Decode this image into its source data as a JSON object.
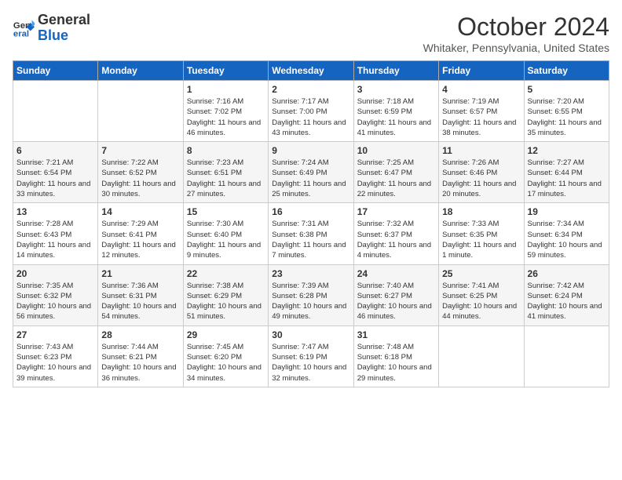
{
  "logo": {
    "general": "General",
    "blue": "Blue"
  },
  "header": {
    "month": "October 2024",
    "location": "Whitaker, Pennsylvania, United States"
  },
  "days_of_week": [
    "Sunday",
    "Monday",
    "Tuesday",
    "Wednesday",
    "Thursday",
    "Friday",
    "Saturday"
  ],
  "weeks": [
    [
      {
        "day": "",
        "sunrise": "",
        "sunset": "",
        "daylight": ""
      },
      {
        "day": "",
        "sunrise": "",
        "sunset": "",
        "daylight": ""
      },
      {
        "day": "1",
        "sunrise": "Sunrise: 7:16 AM",
        "sunset": "Sunset: 7:02 PM",
        "daylight": "Daylight: 11 hours and 46 minutes."
      },
      {
        "day": "2",
        "sunrise": "Sunrise: 7:17 AM",
        "sunset": "Sunset: 7:00 PM",
        "daylight": "Daylight: 11 hours and 43 minutes."
      },
      {
        "day": "3",
        "sunrise": "Sunrise: 7:18 AM",
        "sunset": "Sunset: 6:59 PM",
        "daylight": "Daylight: 11 hours and 41 minutes."
      },
      {
        "day": "4",
        "sunrise": "Sunrise: 7:19 AM",
        "sunset": "Sunset: 6:57 PM",
        "daylight": "Daylight: 11 hours and 38 minutes."
      },
      {
        "day": "5",
        "sunrise": "Sunrise: 7:20 AM",
        "sunset": "Sunset: 6:55 PM",
        "daylight": "Daylight: 11 hours and 35 minutes."
      }
    ],
    [
      {
        "day": "6",
        "sunrise": "Sunrise: 7:21 AM",
        "sunset": "Sunset: 6:54 PM",
        "daylight": "Daylight: 11 hours and 33 minutes."
      },
      {
        "day": "7",
        "sunrise": "Sunrise: 7:22 AM",
        "sunset": "Sunset: 6:52 PM",
        "daylight": "Daylight: 11 hours and 30 minutes."
      },
      {
        "day": "8",
        "sunrise": "Sunrise: 7:23 AM",
        "sunset": "Sunset: 6:51 PM",
        "daylight": "Daylight: 11 hours and 27 minutes."
      },
      {
        "day": "9",
        "sunrise": "Sunrise: 7:24 AM",
        "sunset": "Sunset: 6:49 PM",
        "daylight": "Daylight: 11 hours and 25 minutes."
      },
      {
        "day": "10",
        "sunrise": "Sunrise: 7:25 AM",
        "sunset": "Sunset: 6:47 PM",
        "daylight": "Daylight: 11 hours and 22 minutes."
      },
      {
        "day": "11",
        "sunrise": "Sunrise: 7:26 AM",
        "sunset": "Sunset: 6:46 PM",
        "daylight": "Daylight: 11 hours and 20 minutes."
      },
      {
        "day": "12",
        "sunrise": "Sunrise: 7:27 AM",
        "sunset": "Sunset: 6:44 PM",
        "daylight": "Daylight: 11 hours and 17 minutes."
      }
    ],
    [
      {
        "day": "13",
        "sunrise": "Sunrise: 7:28 AM",
        "sunset": "Sunset: 6:43 PM",
        "daylight": "Daylight: 11 hours and 14 minutes."
      },
      {
        "day": "14",
        "sunrise": "Sunrise: 7:29 AM",
        "sunset": "Sunset: 6:41 PM",
        "daylight": "Daylight: 11 hours and 12 minutes."
      },
      {
        "day": "15",
        "sunrise": "Sunrise: 7:30 AM",
        "sunset": "Sunset: 6:40 PM",
        "daylight": "Daylight: 11 hours and 9 minutes."
      },
      {
        "day": "16",
        "sunrise": "Sunrise: 7:31 AM",
        "sunset": "Sunset: 6:38 PM",
        "daylight": "Daylight: 11 hours and 7 minutes."
      },
      {
        "day": "17",
        "sunrise": "Sunrise: 7:32 AM",
        "sunset": "Sunset: 6:37 PM",
        "daylight": "Daylight: 11 hours and 4 minutes."
      },
      {
        "day": "18",
        "sunrise": "Sunrise: 7:33 AM",
        "sunset": "Sunset: 6:35 PM",
        "daylight": "Daylight: 11 hours and 1 minute."
      },
      {
        "day": "19",
        "sunrise": "Sunrise: 7:34 AM",
        "sunset": "Sunset: 6:34 PM",
        "daylight": "Daylight: 10 hours and 59 minutes."
      }
    ],
    [
      {
        "day": "20",
        "sunrise": "Sunrise: 7:35 AM",
        "sunset": "Sunset: 6:32 PM",
        "daylight": "Daylight: 10 hours and 56 minutes."
      },
      {
        "day": "21",
        "sunrise": "Sunrise: 7:36 AM",
        "sunset": "Sunset: 6:31 PM",
        "daylight": "Daylight: 10 hours and 54 minutes."
      },
      {
        "day": "22",
        "sunrise": "Sunrise: 7:38 AM",
        "sunset": "Sunset: 6:29 PM",
        "daylight": "Daylight: 10 hours and 51 minutes."
      },
      {
        "day": "23",
        "sunrise": "Sunrise: 7:39 AM",
        "sunset": "Sunset: 6:28 PM",
        "daylight": "Daylight: 10 hours and 49 minutes."
      },
      {
        "day": "24",
        "sunrise": "Sunrise: 7:40 AM",
        "sunset": "Sunset: 6:27 PM",
        "daylight": "Daylight: 10 hours and 46 minutes."
      },
      {
        "day": "25",
        "sunrise": "Sunrise: 7:41 AM",
        "sunset": "Sunset: 6:25 PM",
        "daylight": "Daylight: 10 hours and 44 minutes."
      },
      {
        "day": "26",
        "sunrise": "Sunrise: 7:42 AM",
        "sunset": "Sunset: 6:24 PM",
        "daylight": "Daylight: 10 hours and 41 minutes."
      }
    ],
    [
      {
        "day": "27",
        "sunrise": "Sunrise: 7:43 AM",
        "sunset": "Sunset: 6:23 PM",
        "daylight": "Daylight: 10 hours and 39 minutes."
      },
      {
        "day": "28",
        "sunrise": "Sunrise: 7:44 AM",
        "sunset": "Sunset: 6:21 PM",
        "daylight": "Daylight: 10 hours and 36 minutes."
      },
      {
        "day": "29",
        "sunrise": "Sunrise: 7:45 AM",
        "sunset": "Sunset: 6:20 PM",
        "daylight": "Daylight: 10 hours and 34 minutes."
      },
      {
        "day": "30",
        "sunrise": "Sunrise: 7:47 AM",
        "sunset": "Sunset: 6:19 PM",
        "daylight": "Daylight: 10 hours and 32 minutes."
      },
      {
        "day": "31",
        "sunrise": "Sunrise: 7:48 AM",
        "sunset": "Sunset: 6:18 PM",
        "daylight": "Daylight: 10 hours and 29 minutes."
      },
      {
        "day": "",
        "sunrise": "",
        "sunset": "",
        "daylight": ""
      },
      {
        "day": "",
        "sunrise": "",
        "sunset": "",
        "daylight": ""
      }
    ]
  ]
}
